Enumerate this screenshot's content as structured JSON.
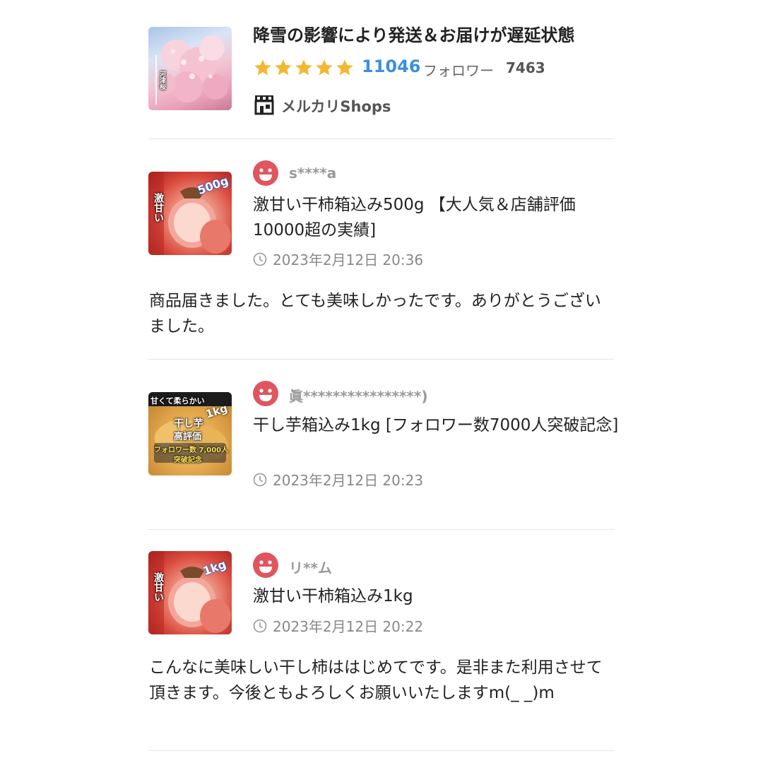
{
  "shop": {
    "title": "降雪の影響により発送＆お届けが遅延状態",
    "rating_count": "11046",
    "follower_label": "フォロワー",
    "follower_count": "7463",
    "shops_label": "メルカリShops",
    "avatar_caption": "河津桜",
    "star_color": "#f5b731",
    "rating_color": "#3b8fde"
  },
  "reviews": [
    {
      "username": "s****a",
      "product": "激甘い干柿箱込み500g 【大人気＆店舗評価10000超の実績]",
      "time": "2023年2月12日 20:36",
      "comment": "商品届きました。とても美味しかったです。ありがとうございました。",
      "thumb_badge": "500g",
      "thumb_side_text": "激甘い"
    },
    {
      "username": "眞****************)",
      "product": "干し芋箱込み1kg [フォロワー数7000人突破記念]",
      "time": "2023年2月12日 20:23",
      "comment": "",
      "thumb_badge": "1kg",
      "thumb_top_text": "甘くて柔らかい",
      "thumb_mid_text1": "干し芋",
      "thumb_mid_text2": "高評価",
      "thumb_bottom_text1": "フォロワー数 7,000人",
      "thumb_bottom_text2": "突破記念"
    },
    {
      "username": "リ**ム",
      "product": "激甘い干柿箱込み1kg",
      "time": "2023年2月12日 20:22",
      "comment": "こんなに美味しい干し柿ははじめてです。是非また利用させて頂きます。今後ともよろしくお願いいたしますm(_ _)m",
      "thumb_badge": "1kg",
      "thumb_side_text": "激甘い"
    }
  ],
  "avatar_color": "#e0555f"
}
